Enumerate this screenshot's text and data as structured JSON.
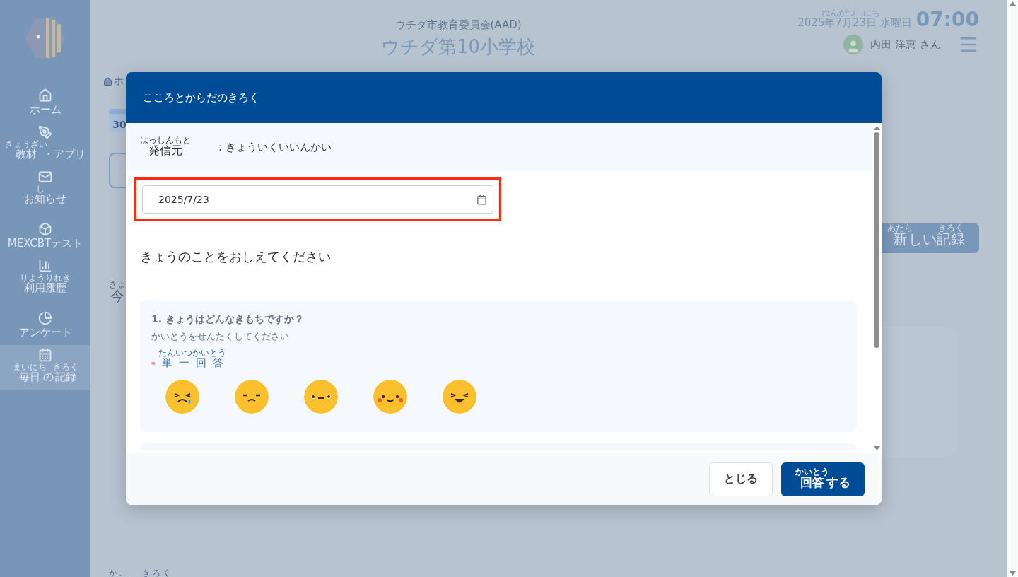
{
  "sidebar": {
    "items": [
      {
        "kind": "home",
        "label": [
          {
            "text": "ホーム"
          }
        ],
        "selected": false
      },
      {
        "kind": "pencil",
        "label": [
          {
            "text": "教材",
            "ruby": "きょうざい"
          },
          {
            "text": "・アプリ"
          }
        ],
        "selected": false
      },
      {
        "kind": "mail",
        "label": [
          {
            "text": "お"
          },
          {
            "text": "知",
            "ruby": "し"
          },
          {
            "text": "らせ"
          }
        ],
        "selected": false
      },
      {
        "kind": "cube",
        "label": [
          {
            "text": "MEXCBTテスト"
          }
        ],
        "selected": false
      },
      {
        "kind": "chart",
        "label": [
          {
            "text": "利用履歴",
            "ruby": "りようりれき"
          }
        ],
        "selected": false
      },
      {
        "kind": "pie",
        "label": [
          {
            "text": "アンケート"
          }
        ],
        "selected": false
      },
      {
        "kind": "calendar",
        "label": [
          {
            "text": "毎日",
            "ruby": "まいにち"
          },
          {
            "text": "の"
          },
          {
            "text": "記録",
            "ruby": "きろく"
          }
        ],
        "selected": true
      }
    ]
  },
  "header": {
    "organization": "ウチダ市教育委員会(AAD)",
    "school": "ウチダ第10小学校",
    "date": [
      {
        "text": "2025"
      },
      {
        "text": "年",
        "ruby": "ねん"
      },
      {
        "text": "7"
      },
      {
        "text": "月",
        "ruby": "がつ"
      },
      {
        "text": "23"
      },
      {
        "text": "日",
        "ruby": "にち"
      },
      {
        "text": " 水曜日"
      }
    ],
    "time": "07:00",
    "user": "内田 洋恵 さん"
  },
  "background": {
    "breadcrumb": "ホ",
    "calendar_number": "30",
    "today_heading": "今",
    "today_ruby": "きょ",
    "new_record_button": [
      {
        "text": "新",
        "ruby": "あたら"
      },
      {
        "text": "しい"
      },
      {
        "text": "記録",
        "ruby": "きろく"
      }
    ],
    "past_records_ruby": "か こ　　き ろ く"
  },
  "modal": {
    "title": "こころとからだのきろく",
    "sender": {
      "label": [
        {
          "text": "発信元",
          "ruby": "はっしんもと"
        }
      ],
      "value": "：きょういくいいんかい"
    },
    "date_field": {
      "value": "2025/7/23",
      "highlighted": true
    },
    "prompt": "きょうのことをおしえてください",
    "questions": [
      {
        "title": "1. きょうはどんなきもちですか？",
        "hint": "かいとうをせんたくしてください",
        "required": true,
        "required_mark": "*",
        "answer_type": [
          {
            "text": "単",
            "ruby": "たん"
          },
          {
            "text": "一",
            "ruby": "いつ"
          },
          {
            "text": "回",
            "ruby": "かい"
          },
          {
            "text": "答",
            "ruby": "とう"
          }
        ],
        "options": [
          {
            "kind": "crying",
            "selected": false
          },
          {
            "kind": "sad",
            "selected": false
          },
          {
            "kind": "neutral",
            "selected": false
          },
          {
            "kind": "smile",
            "selected": false
          },
          {
            "kind": "laugh",
            "selected": false
          }
        ]
      }
    ],
    "buttons": {
      "close": [
        {
          "text": "とじる"
        }
      ],
      "submit": [
        {
          "text": "回答",
          "ruby": "かいとう"
        },
        {
          "text": "する"
        }
      ]
    }
  }
}
